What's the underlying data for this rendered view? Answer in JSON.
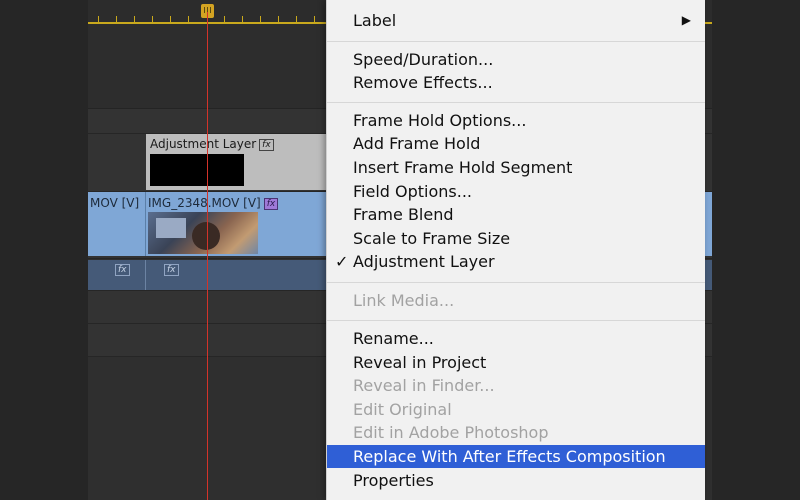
{
  "timeline": {
    "adjustment_clip_label": "Adjustment Layer",
    "clip_left_label": "MOV [V]",
    "clip_main_label": "IMG_2348.MOV [V]",
    "fx_text": "fx",
    "playhead_color": "#d3332a",
    "clip_color": "#7fa7d6",
    "adjustment_clip_color": "#bdbdbd"
  },
  "context_menu": {
    "highlight_color": "#2f5fd6",
    "items": [
      {
        "label": "Label",
        "state": "enabled",
        "submenu": true
      },
      {
        "label": "Speed/Duration...",
        "state": "enabled"
      },
      {
        "label": "Remove Effects...",
        "state": "enabled"
      },
      {
        "label": "Frame Hold Options...",
        "state": "enabled"
      },
      {
        "label": "Add Frame Hold",
        "state": "enabled"
      },
      {
        "label": "Insert Frame Hold Segment",
        "state": "enabled"
      },
      {
        "label": "Field Options...",
        "state": "enabled"
      },
      {
        "label": "Frame Blend",
        "state": "enabled"
      },
      {
        "label": "Scale to Frame Size",
        "state": "enabled"
      },
      {
        "label": "Adjustment Layer",
        "state": "enabled",
        "checked": true
      },
      {
        "label": "Link Media...",
        "state": "disabled"
      },
      {
        "label": "Rename...",
        "state": "enabled"
      },
      {
        "label": "Reveal in Project",
        "state": "enabled"
      },
      {
        "label": "Reveal in Finder...",
        "state": "disabled"
      },
      {
        "label": "Edit Original",
        "state": "disabled"
      },
      {
        "label": "Edit in Adobe Photoshop",
        "state": "disabled"
      },
      {
        "label": "Replace With After Effects Composition",
        "state": "highlighted"
      },
      {
        "label": "Properties",
        "state": "enabled"
      }
    ],
    "submenu_arrow": "▶",
    "check_mark": "✓"
  }
}
